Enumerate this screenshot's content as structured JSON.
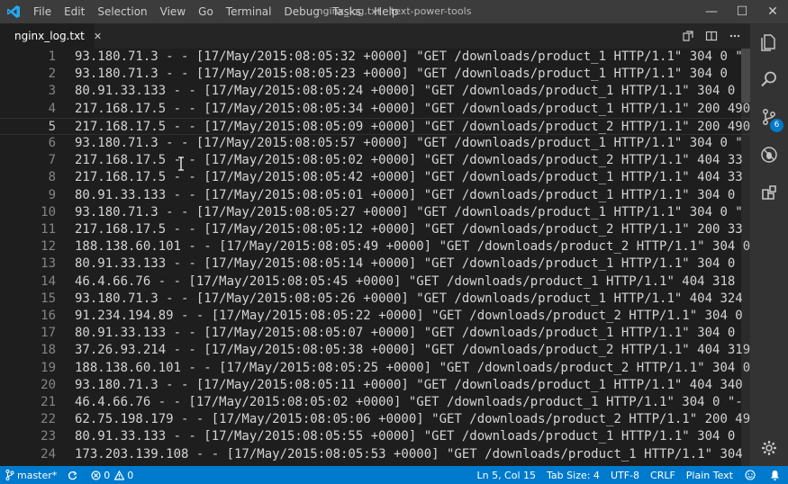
{
  "window": {
    "title": "nginx_log.txt - text-power-tools",
    "minimize_glyph": "—",
    "maximize_glyph": "☐",
    "close_glyph": "✕"
  },
  "menu": [
    "File",
    "Edit",
    "Selection",
    "View",
    "Go",
    "Terminal",
    "Debug",
    "Tasks",
    "Help"
  ],
  "tab": {
    "label": "nginx_log.txt",
    "close_glyph": "✕",
    "icon": "file-text-icon"
  },
  "editor": {
    "active_line": 5,
    "lines": [
      {
        "n": "1",
        "text": "93.180.71.3 - - [17/May/2015:08:05:32 +0000] \"GET /downloads/product_1 HTTP/1.1\" 304 0 \""
      },
      {
        "n": "2",
        "text": "93.180.71.3 - - [17/May/2015:08:05:23 +0000] \"GET /downloads/product_1 HTTP/1.1\" 304 0"
      },
      {
        "n": "3",
        "text": "80.91.33.133 - - [17/May/2015:08:05:24 +0000] \"GET /downloads/product_1 HTTP/1.1\" 304 0"
      },
      {
        "n": "4",
        "text": "217.168.17.5 - - [17/May/2015:08:05:34 +0000] \"GET /downloads/product_1 HTTP/1.1\" 200 490"
      },
      {
        "n": "5",
        "text": "217.168.17.5 - - [17/May/2015:08:05:09 +0000] \"GET /downloads/product_2 HTTP/1.1\" 200 490"
      },
      {
        "n": "6",
        "text": "93.180.71.3 - - [17/May/2015:08:05:57 +0000] \"GET /downloads/product_1 HTTP/1.1\" 304 0 \""
      },
      {
        "n": "7",
        "text": "217.168.17.5 - - [17/May/2015:08:05:02 +0000] \"GET /downloads/product_2 HTTP/1.1\" 404 33"
      },
      {
        "n": "8",
        "text": "217.168.17.5 - - [17/May/2015:08:05:42 +0000] \"GET /downloads/product_1 HTTP/1.1\" 404 33"
      },
      {
        "n": "9",
        "text": "80.91.33.133 - - [17/May/2015:08:05:01 +0000] \"GET /downloads/product_1 HTTP/1.1\" 304 0"
      },
      {
        "n": "10",
        "text": "93.180.71.3 - - [17/May/2015:08:05:27 +0000] \"GET /downloads/product_1 HTTP/1.1\" 304 0 \""
      },
      {
        "n": "11",
        "text": "217.168.17.5 - - [17/May/2015:08:05:12 +0000] \"GET /downloads/product_2 HTTP/1.1\" 200 33"
      },
      {
        "n": "12",
        "text": "188.138.60.101 - - [17/May/2015:08:05:49 +0000] \"GET /downloads/product_2 HTTP/1.1\" 304 0"
      },
      {
        "n": "13",
        "text": "80.91.33.133 - - [17/May/2015:08:05:14 +0000] \"GET /downloads/product_1 HTTP/1.1\" 304 0"
      },
      {
        "n": "14",
        "text": "46.4.66.76 - - [17/May/2015:08:05:45 +0000] \"GET /downloads/product_1 HTTP/1.1\" 404 318"
      },
      {
        "n": "15",
        "text": "93.180.71.3 - - [17/May/2015:08:05:26 +0000] \"GET /downloads/product_1 HTTP/1.1\" 404 324"
      },
      {
        "n": "16",
        "text": "91.234.194.89 - - [17/May/2015:08:05:22 +0000] \"GET /downloads/product_2 HTTP/1.1\" 304 0"
      },
      {
        "n": "17",
        "text": "80.91.33.133 - - [17/May/2015:08:05:07 +0000] \"GET /downloads/product_1 HTTP/1.1\" 304 0"
      },
      {
        "n": "18",
        "text": "37.26.93.214 - - [17/May/2015:08:05:38 +0000] \"GET /downloads/product_2 HTTP/1.1\" 404 319"
      },
      {
        "n": "19",
        "text": "188.138.60.101 - - [17/May/2015:08:05:25 +0000] \"GET /downloads/product_2 HTTP/1.1\" 304 0"
      },
      {
        "n": "20",
        "text": "93.180.71.3 - - [17/May/2015:08:05:11 +0000] \"GET /downloads/product_1 HTTP/1.1\" 404 340"
      },
      {
        "n": "21",
        "text": "46.4.66.76 - - [17/May/2015:08:05:02 +0000] \"GET /downloads/product_1 HTTP/1.1\" 304 0 \"-"
      },
      {
        "n": "22",
        "text": "62.75.198.179 - - [17/May/2015:08:05:06 +0000] \"GET /downloads/product_2 HTTP/1.1\" 200 49"
      },
      {
        "n": "23",
        "text": "80.91.33.133 - - [17/May/2015:08:05:55 +0000] \"GET /downloads/product_1 HTTP/1.1\" 304 0"
      },
      {
        "n": "24",
        "text": "173.203.139.108 - - [17/May/2015:08:05:53 +0000] \"GET /downloads/product_1 HTTP/1.1\" 304"
      }
    ]
  },
  "statusbar": {
    "branch": "master*",
    "errors": "0",
    "warnings": "0",
    "position": "Ln 5, Col 15",
    "tab_size": "Tab Size: 4",
    "encoding": "UTF-8",
    "eol": "CRLF",
    "language": "Plain Text"
  },
  "activity": {
    "scm_badge": "6"
  },
  "colors": {
    "accent": "#007acc",
    "editor_bg": "#1e1e1e",
    "titlebar_bg": "#3c3c3c",
    "activitybar_bg": "#333333"
  }
}
